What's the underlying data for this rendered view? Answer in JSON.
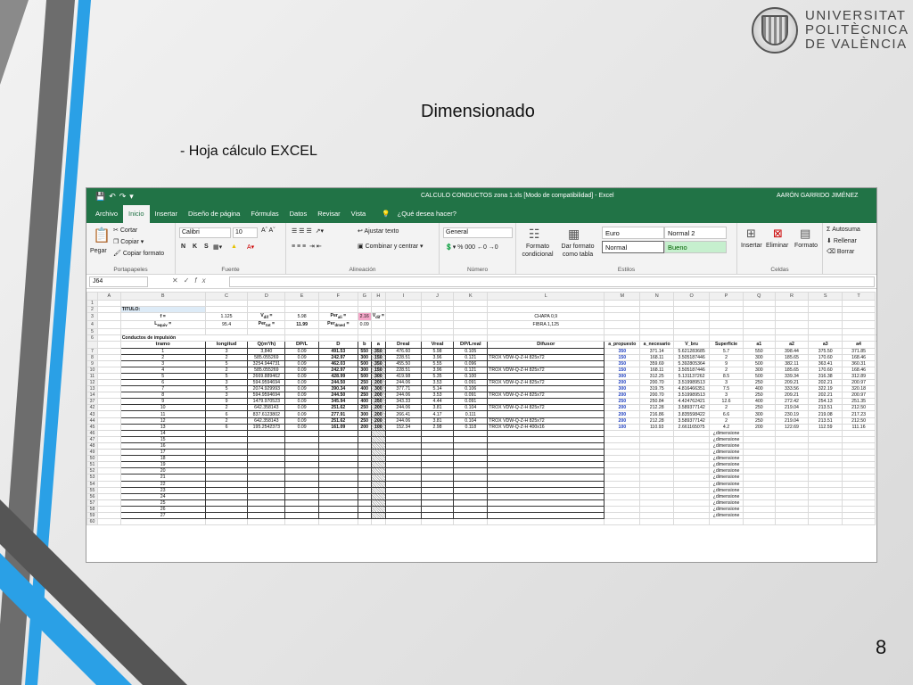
{
  "slide": {
    "title": "Dimensionado",
    "bullet": "- Hoja cálculo EXCEL",
    "page_number": "8",
    "logo_text": [
      "UNIVERSITAT",
      "POLITÈCNICA",
      "DE VALÈNCIA"
    ]
  },
  "excel": {
    "window_title": "CALCULO CONDUCTOS zona 1.xls  [Modo de compatibilidad]  -  Excel",
    "user": "AARÓN GARRIDO JIMÉNEZ",
    "menu": [
      "Archivo",
      "Inicio",
      "Insertar",
      "Diseño de página",
      "Fórmulas",
      "Datos",
      "Revisar",
      "Vista"
    ],
    "search": "¿Qué desea hacer?",
    "ribbon": {
      "paste": "Pegar",
      "cut": "Cortar",
      "copy": "Copiar",
      "format_painter": "Copiar formato",
      "clipboard": "Portapapeles",
      "font_name": "Calibri",
      "font_size": "10",
      "font_group": "Fuente",
      "wrap_text": "Ajustar texto",
      "merge": "Combinar y centrar",
      "alignment": "Alineación",
      "number_format": "General",
      "number_group": "Número",
      "conditional": "Formato condicional",
      "as_table": "Dar formato como tabla",
      "styles": [
        "Euro",
        "Normal 2",
        "Normal",
        "Bueno"
      ],
      "styles_group": "Estilos",
      "insert": "Insertar",
      "delete": "Eliminar",
      "format": "Formato",
      "cells_group": "Celdas",
      "autosum": "Autosuma",
      "fill": "Rellenar",
      "clear": "Borrar"
    },
    "name_box": "J64",
    "columns": [
      "",
      "A",
      "B",
      "C",
      "D",
      "E",
      "F",
      "G",
      "H",
      "I",
      "J",
      "K",
      "L",
      "M",
      "N",
      "O",
      "P",
      "Q",
      "R",
      "S",
      "T"
    ],
    "header_rows": {
      "r2_title": "TITULO:",
      "r3": [
        "f =",
        "1.125",
        "V<sub>dif</sub> =",
        "5.98",
        "Per<sub>ali</sub> =",
        "2.16",
        "V<sub>dif</sub> =",
        "CHAPA 0,9"
      ],
      "r4": [
        "L<sub>equiv</sub> =",
        "95.4",
        "Per<sub>tot</sub> =",
        "11.99",
        "Per<sub>dmed</sub> =",
        "0.09",
        "FIBRA 1,125"
      ],
      "r6_section": "Conductos de impulsión",
      "r6_cols": [
        "tramo",
        "longitud",
        "Q(m³/h)",
        "DP/L",
        "D",
        "b",
        "a",
        "Dreal",
        "Vreal",
        "DP/Lreal",
        "Difusor"
      ],
      "r6_right": [
        "a_propuesto",
        "a_necesario",
        "V_bru",
        "Superficie",
        "a1",
        "a2",
        "a3",
        "a4"
      ]
    },
    "data_rows": [
      {
        "row": "7",
        "tramo": "1",
        "long": "3",
        "q": "3,840",
        "dpl": "0.09",
        "d": "491.53",
        "b": "550",
        "a": "350",
        "dreal": "476.60",
        "vreal": "5.98",
        "dplr": "0.105",
        "dif": "",
        "ap": "350",
        "an": "371.14",
        "vb": "5.621283685",
        "sup": "5.7",
        "a1": "550",
        "a2": "398.44",
        "a3": "375.50",
        "a4": "371.85"
      },
      {
        "row": "8",
        "tramo": "2",
        "long": "2",
        "q": "585.055269",
        "dpl": "0.09",
        "d": "242.97",
        "b": "300",
        "a": "150",
        "dreal": "228.51",
        "vreal": "3.96",
        "dplr": "0.121",
        "dif": "TROX VDW-Q-Z-H 825x72",
        "ap": "150",
        "an": "168.11",
        "vb": "3.505187446",
        "sup": "2",
        "a1": "300",
        "a2": "185.65",
        "a3": "170.60",
        "a4": "168.46"
      },
      {
        "row": "9",
        "tramo": "3",
        "long": "5",
        "q": "3254.944731",
        "dpl": "0.09",
        "d": "462.03",
        "b": "500",
        "a": "350",
        "dreal": "455.50",
        "vreal": "5.55",
        "dplr": "0.096",
        "dif": "",
        "ap": "350",
        "an": "359.69",
        "vb": "5.392805364",
        "sup": "9",
        "a1": "500",
        "a2": "382.11",
        "a3": "363.41",
        "a4": "360.31"
      },
      {
        "row": "10",
        "tramo": "4",
        "long": "2",
        "q": "585.055269",
        "dpl": "0.09",
        "d": "242.97",
        "b": "300",
        "a": "150",
        "dreal": "228.51",
        "vreal": "3.96",
        "dplr": "0.121",
        "dif": "TROX VDW-Q-Z-H 825x72",
        "ap": "150",
        "an": "168.11",
        "vb": "3.505187446",
        "sup": "2",
        "a1": "300",
        "a2": "185.65",
        "a3": "170.60",
        "a4": "168.46"
      },
      {
        "row": "11",
        "tramo": "5",
        "long": "5",
        "q": "2669.889462",
        "dpl": "0.09",
        "d": "428.99",
        "b": "500",
        "a": "300",
        "dreal": "419.98",
        "vreal": "5.35",
        "dplr": "0.100",
        "dif": "",
        "ap": "300",
        "an": "312.25",
        "vb": "5.131137262",
        "sup": "8.5",
        "a1": "500",
        "a2": "339.34",
        "a3": "316.38",
        "a4": "312.89"
      },
      {
        "row": "12",
        "tramo": "6",
        "long": "3",
        "q": "594.9594694",
        "dpl": "0.09",
        "d": "244.50",
        "b": "250",
        "a": "200",
        "dreal": "244.06",
        "vreal": "3.53",
        "dplr": "0.091",
        "dif": "TROX VDW-Q-Z-H 825x72",
        "ap": "200",
        "an": "200.70",
        "vb": "3.519989513",
        "sup": "3",
        "a1": "250",
        "a2": "209.21",
        "a3": "202.21",
        "a4": "200.97"
      },
      {
        "row": "13",
        "tramo": "7",
        "long": "5",
        "q": "2074.929993",
        "dpl": "0.09",
        "d": "390.34",
        "b": "400",
        "a": "300",
        "dreal": "377.71",
        "vreal": "5.14",
        "dplr": "0.106",
        "dif": "",
        "ap": "300",
        "an": "319.75",
        "vb": "4.816466351",
        "sup": "7.5",
        "a1": "400",
        "a2": "333.56",
        "a3": "322.19",
        "a4": "320.18"
      },
      {
        "row": "14",
        "tramo": "8",
        "long": "3",
        "q": "594.9594694",
        "dpl": "0.09",
        "d": "244.50",
        "b": "250",
        "a": "200",
        "dreal": "244.06",
        "vreal": "3.53",
        "dplr": "0.091",
        "dif": "TROX VDW-Q-Z-H 825x72",
        "ap": "200",
        "an": "200.70",
        "vb": "3.519989513",
        "sup": "3",
        "a1": "250",
        "a2": "209.21",
        "a3": "202.21",
        "a4": "200.97"
      },
      {
        "row": "37",
        "tramo": "9",
        "long": "9",
        "q": "1479.970523",
        "dpl": "0.09",
        "d": "345.94",
        "b": "400",
        "a": "250",
        "dreal": "343.33",
        "vreal": "4.44",
        "dplr": "0.091",
        "dif": "",
        "ap": "250",
        "an": "250.84",
        "vb": "4.424762421",
        "sup": "12.6",
        "a1": "400",
        "a2": "272.42",
        "a3": "254.13",
        "a4": "251.35"
      },
      {
        "row": "42",
        "tramo": "10",
        "long": "2",
        "q": "642.358143",
        "dpl": "0.09",
        "d": "251.62",
        "b": "250",
        "a": "200",
        "dreal": "244.06",
        "vreal": "3.81",
        "dplr": "0.104",
        "dif": "TROX VDW-Q-Z-H 825x72",
        "ap": "200",
        "an": "212.28",
        "vb": "3.589377142",
        "sup": "2",
        "a1": "250",
        "a2": "219.04",
        "a3": "213.51",
        "a4": "212.50"
      },
      {
        "row": "43",
        "tramo": "11",
        "long": "6",
        "q": "837.6123802",
        "dpl": "0.09",
        "d": "277.91",
        "b": "300",
        "a": "200",
        "dreal": "266.41",
        "vreal": "4.17",
        "dplr": "0.111",
        "dif": "",
        "ap": "200",
        "an": "216.86",
        "vb": "3.835598422",
        "sup": "6.6",
        "a1": "300",
        "a2": "230.19",
        "a3": "219.08",
        "a4": "217.23"
      },
      {
        "row": "44",
        "tramo": "12",
        "long": "2",
        "q": "642.358143",
        "dpl": "0.09",
        "d": "251.62",
        "b": "250",
        "a": "200",
        "dreal": "244.06",
        "vreal": "3.81",
        "dplr": "0.104",
        "dif": "TROX VDW-Q-Z-H 825x72",
        "ap": "200",
        "an": "212.28",
        "vb": "3.589377142",
        "sup": "2",
        "a1": "250",
        "a2": "219.04",
        "a3": "213.51",
        "a4": "212.50"
      },
      {
        "row": "45",
        "tramo": "13",
        "long": "6",
        "q": "195.2542373",
        "dpl": "0.09",
        "d": "161.09",
        "b": "200",
        "a": "100",
        "dreal": "152.34",
        "vreal": "2.98",
        "dplr": "0.118",
        "dif": "TROX VDW-Q-Z-H 400x16",
        "ap": "100",
        "an": "110.93",
        "vb": "2.661165075",
        "sup": "4.2",
        "a1": "200",
        "a2": "122.69",
        "a3": "112.59",
        "a4": "111.16"
      }
    ],
    "empty_rows": [
      {
        "row": "46",
        "tramo": "14"
      },
      {
        "row": "47",
        "tramo": "15"
      },
      {
        "row": "48",
        "tramo": "16"
      },
      {
        "row": "49",
        "tramo": "17"
      },
      {
        "row": "50",
        "tramo": "18"
      },
      {
        "row": "51",
        "tramo": "19"
      },
      {
        "row": "52",
        "tramo": "20"
      },
      {
        "row": "53",
        "tramo": "21"
      },
      {
        "row": "54",
        "tramo": "22"
      },
      {
        "row": "55",
        "tramo": "23"
      },
      {
        "row": "56",
        "tramo": "24"
      },
      {
        "row": "57",
        "tramo": "25"
      },
      {
        "row": "58",
        "tramo": "26"
      },
      {
        "row": "59",
        "tramo": "27"
      }
    ],
    "empty_p_text": "¿dimensione",
    "trailing_row": "60"
  }
}
